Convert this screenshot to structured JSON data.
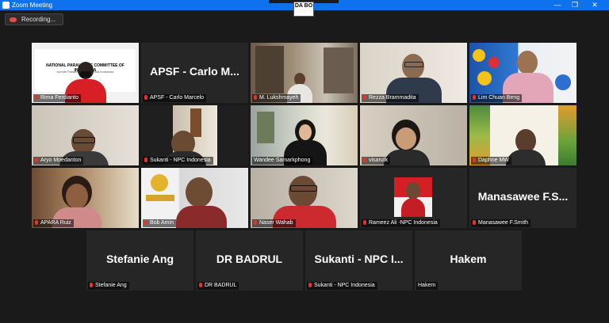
{
  "window": {
    "title": "Zoom Meeting",
    "min_glyph": "—",
    "max_glyph": "❐",
    "close_glyph": "✕"
  },
  "logo_text": "DA BO",
  "recording": {
    "label": "Recording..."
  },
  "banners": {
    "npc_line1": "NATIONAL PARALYMPIC COMMITTEE OF INDONESIA",
    "npc_line2": "Komite Paralimpiade Nasional Indonesia"
  },
  "participants": [
    {
      "label": "Rima Ferdianto",
      "big": ""
    },
    {
      "label": "APSF - Carlo Marcelo",
      "big": "APSF - Carlo M..."
    },
    {
      "label": "M. Lukshmayeh",
      "big": ""
    },
    {
      "label": "Rezza Brammadita",
      "big": ""
    },
    {
      "label": "Lim Chuan Beng",
      "big": ""
    },
    {
      "label": "Aryo Moedanton",
      "big": ""
    },
    {
      "label": "Sukanti - NPC Indonesia",
      "big": ""
    },
    {
      "label": "Wandee Samarkphong",
      "big": ""
    },
    {
      "label": "visarutk",
      "big": ""
    },
    {
      "label": "Daphne MW",
      "big": ""
    },
    {
      "label": "APARA Ruiz",
      "big": ""
    },
    {
      "label": "Bob Amin",
      "big": ""
    },
    {
      "label": "Naser Wahab",
      "big": ""
    },
    {
      "label": "Rameez Ali -NPC Indonesia",
      "big": ""
    },
    {
      "label": "Manasawee F.Smith",
      "big": "Manasawee F.S..."
    },
    {
      "label": "Stefanie Ang",
      "big": "Stefanie Ang"
    },
    {
      "label": "DR BADRUL",
      "big": "DR BADRUL"
    },
    {
      "label": "Sukanti - NPC Indonesia",
      "big": "Sukanti - NPC I..."
    },
    {
      "label": "Hakem",
      "big": "Hakem"
    }
  ]
}
